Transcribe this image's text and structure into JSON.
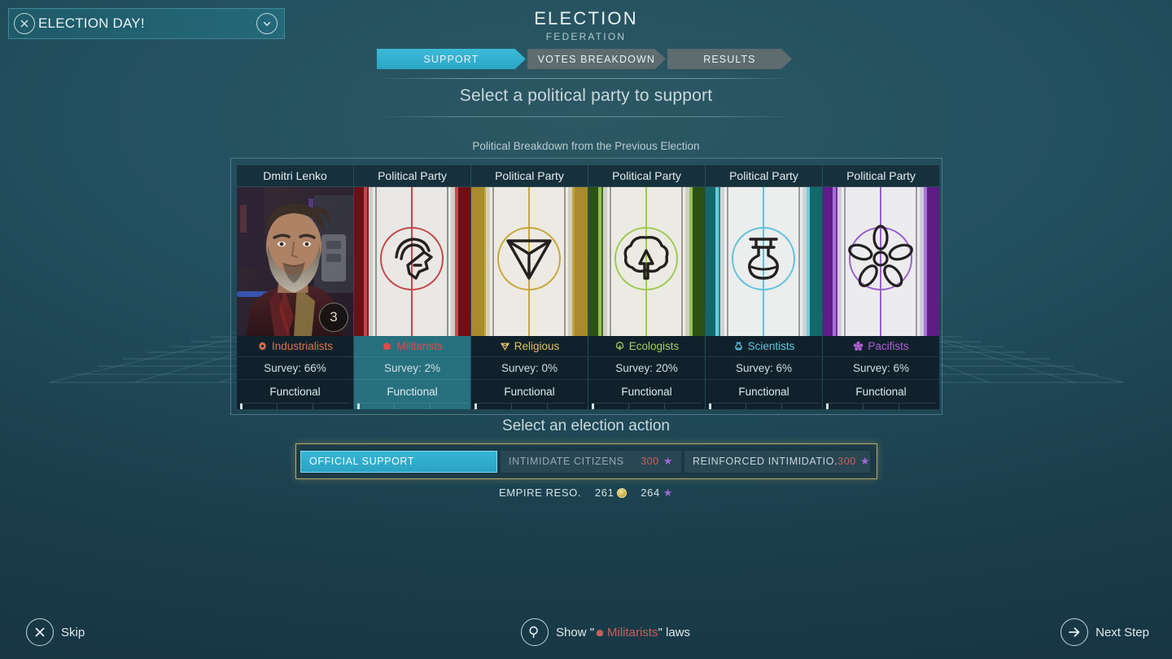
{
  "event_banner": {
    "title": "ELECTION DAY!",
    "close_icon": "close-circle-icon",
    "expand_icon": "chevron-down-icon"
  },
  "header": {
    "title": "ELECTION",
    "subtitle": "FEDERATION"
  },
  "steps": [
    {
      "label": "SUPPORT",
      "active": true
    },
    {
      "label": "VOTES BREAKDOWN",
      "active": false
    },
    {
      "label": "RESULTS",
      "active": false
    }
  ],
  "section_title": "Select a political party to support",
  "breakdown_caption": "Political Breakdown from the Previous Election",
  "parties": [
    {
      "header": "Dmitri Lenko",
      "kind": "portrait",
      "unity_badge": "3",
      "name": "Industrialists",
      "icon": "gear-icon",
      "color": "#d9734f",
      "survey": "Survey: 66%",
      "status": "Functional",
      "selected": false,
      "banner_color": "#b0292f"
    },
    {
      "header": "Political Party",
      "kind": "banner",
      "name": "Militarists",
      "icon": "helmet-icon",
      "color": "#e04a4a",
      "survey": "Survey: 2%",
      "status": "Functional",
      "selected": true,
      "banner_color": "#8e1c21"
    },
    {
      "header": "Political Party",
      "kind": "banner",
      "name": "Religious",
      "icon": "triangle-icon",
      "color": "#e0c261",
      "survey": "Survey: 0%",
      "status": "Functional",
      "selected": false,
      "banner_color": "#c4a33c"
    },
    {
      "header": "Political Party",
      "kind": "banner",
      "name": "Ecologists",
      "icon": "tree-icon",
      "color": "#a7cf5e",
      "survey": "Survey: 20%",
      "status": "Functional",
      "selected": false,
      "banner_color": "#3f6b1e"
    },
    {
      "header": "Political Party",
      "kind": "banner",
      "name": "Scientists",
      "icon": "flask-icon",
      "color": "#5fc6e0",
      "survey": "Survey: 6%",
      "status": "Functional",
      "selected": false,
      "banner_color": "#1d8a8c"
    },
    {
      "header": "Political Party",
      "kind": "banner",
      "name": "Pacifists",
      "icon": "flower-icon",
      "color": "#b05fd6",
      "survey": "Survey: 6%",
      "status": "Functional",
      "selected": false,
      "banner_color": "#7a2ba8"
    }
  ],
  "action": {
    "title": "Select an election action",
    "buttons": [
      {
        "label": "OFFICIAL SUPPORT",
        "cost": "",
        "selected": true
      },
      {
        "label": "INTIMIDATE CITIZENS",
        "cost": "300",
        "selected": false
      },
      {
        "label": "REINFORCED INTIMIDATIO.",
        "cost": "300",
        "selected": false
      }
    ]
  },
  "empire_resources": {
    "label": "EMPIRE RESO.",
    "money": "261",
    "influence": "264"
  },
  "bottom_bar": {
    "skip_label": "Skip",
    "skip_icon": "close-circle-icon",
    "laws_prefix": "Show \"",
    "laws_party": "Militarists",
    "laws_suffix": "\" laws",
    "laws_icon": "magnifier-icon",
    "next_label": "Next Step",
    "next_icon": "arrow-right-icon"
  },
  "colors": {
    "accent": "#2ba6c6",
    "gold_glow": "#b9a86a",
    "selected_card": "#27707e"
  }
}
